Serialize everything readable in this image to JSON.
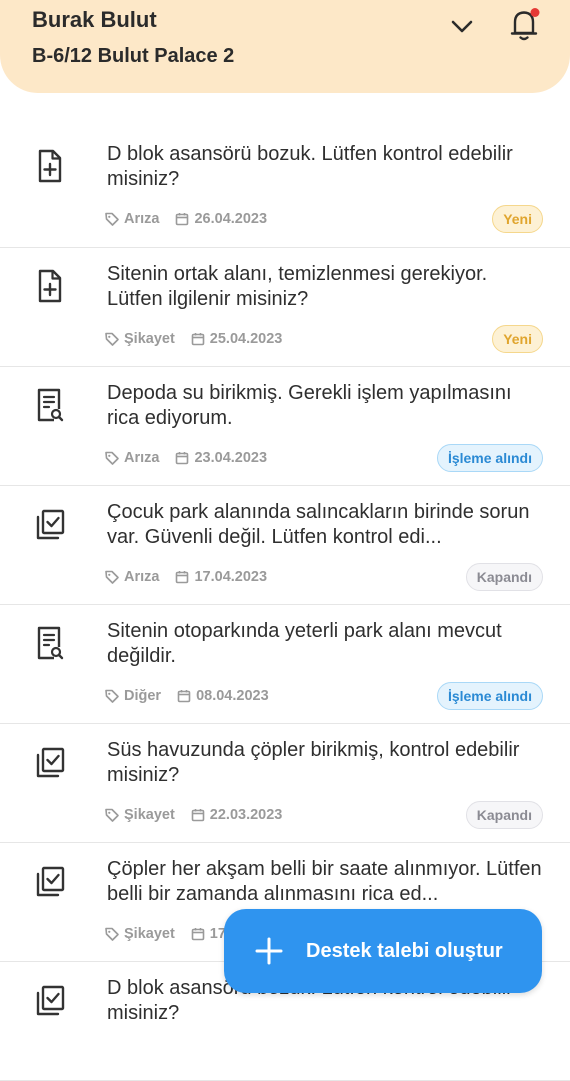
{
  "header": {
    "user_name": "Burak Bulut",
    "site_name": "B-6/12 Bulut Palace 2",
    "notification_dot_color": "#e53935"
  },
  "requests": [
    {
      "title": "D blok asansörü bozuk. Lütfen kontrol edebilir misiniz?",
      "category": "Arıza",
      "date": "26.04.2023",
      "status": "Yeni",
      "status_type": "yeni",
      "icon": "file-plus-icon"
    },
    {
      "title": "Sitenin ortak alanı, temizlenmesi gerekiyor. Lütfen ilgilenir misiniz?",
      "category": "Şikayet",
      "date": "25.04.2023",
      "status": "Yeni",
      "status_type": "yeni",
      "icon": "file-plus-icon"
    },
    {
      "title": "Depoda su birikmiş. Gerekli işlem yapılmasını rica ediyorum.",
      "category": "Arıza",
      "date": "23.04.2023",
      "status": "İşleme alındı",
      "status_type": "isleme",
      "icon": "document-search-icon"
    },
    {
      "title": "Çocuk park alanında salıncakların birinde sorun var. Güvenli değil. Lütfen kontrol edi...",
      "category": "Arıza",
      "date": "17.04.2023",
      "status": "Kapandı",
      "status_type": "kapandi",
      "icon": "stack-check-icon"
    },
    {
      "title": "Sitenin otoparkında yeterli park alanı mevcut değildir.",
      "category": "Diğer",
      "date": "08.04.2023",
      "status": "İşleme alındı",
      "status_type": "isleme",
      "icon": "document-search-icon"
    },
    {
      "title": "Süs havuzunda çöpler birikmiş, kontrol edebilir misiniz?",
      "category": "Şikayet",
      "date": "22.03.2023",
      "status": "Kapandı",
      "status_type": "kapandi",
      "icon": "stack-check-icon"
    },
    {
      "title": "Çöpler her akşam belli bir saate alınmıyor. Lütfen belli bir zamanda alınmasını rica ed...",
      "category": "Şikayet",
      "date": "17",
      "status": "",
      "status_type": "",
      "icon": "stack-check-icon"
    },
    {
      "title": "D blok asansörü bozuk. Lütfen kontrol edebilir misiniz?",
      "category": "",
      "date": "",
      "status": "",
      "status_type": "",
      "icon": "stack-check-icon"
    }
  ],
  "fab": {
    "label": "Destek talebi oluştur"
  },
  "colors": {
    "header_bg": "#fde8c8",
    "accent": "#2f94ef",
    "status_new": "#e0a52e",
    "status_processing": "#2b8ad4",
    "status_closed": "#8b8b93"
  }
}
